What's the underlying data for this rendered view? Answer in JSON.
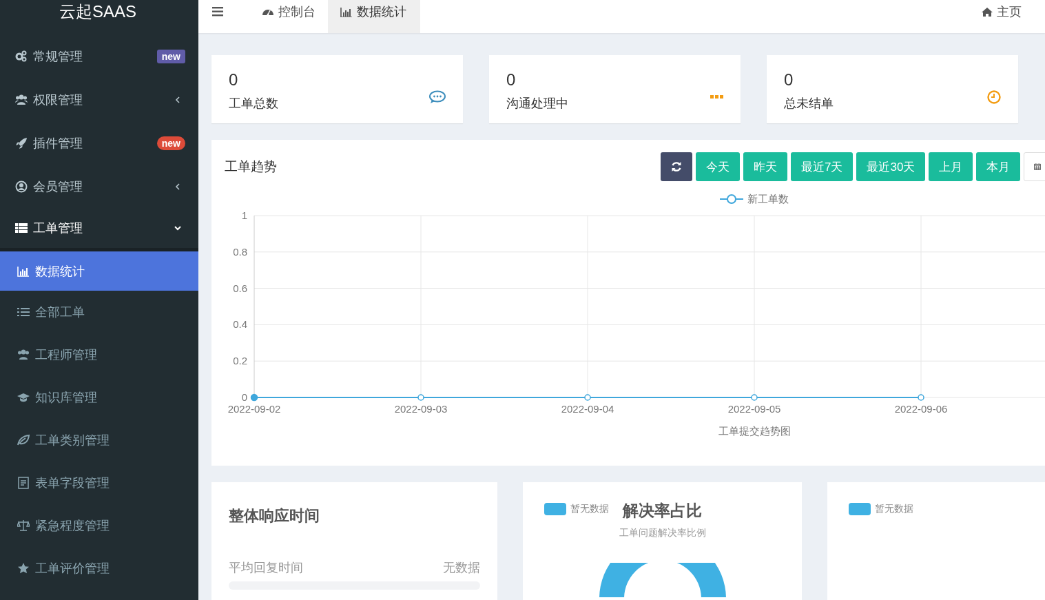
{
  "brand": "云起SAAS",
  "sidebar": {
    "items": [
      {
        "label": "常规管理",
        "badge": {
          "text": "new",
          "color": "#605ca8"
        }
      },
      {
        "label": "权限管理",
        "expanded": false
      },
      {
        "label": "插件管理",
        "badge": {
          "text": "new",
          "color": "#dd4b39"
        }
      },
      {
        "label": "会员管理",
        "expanded": false
      },
      {
        "label": "工单管理",
        "expanded": true,
        "children": [
          {
            "label": "数据统计",
            "selected": true
          },
          {
            "label": "全部工单",
            "selected": false
          },
          {
            "label": "工程师管理",
            "selected": false
          },
          {
            "label": "知识库管理",
            "selected": false
          },
          {
            "label": "工单类别管理",
            "selected": false
          },
          {
            "label": "表单字段管理",
            "selected": false
          },
          {
            "label": "紧急程度管理",
            "selected": false
          },
          {
            "label": "工单评价管理",
            "selected": false
          }
        ]
      }
    ]
  },
  "header": {
    "tabs": [
      {
        "label": "控制台",
        "selected": false
      },
      {
        "label": "数据统计",
        "selected": true
      }
    ],
    "home": "主页"
  },
  "stats": [
    {
      "value": "0",
      "label": "工单总数"
    },
    {
      "value": "0",
      "label": "沟通处理中"
    },
    {
      "value": "0",
      "label": "总未结单"
    }
  ],
  "trend": {
    "title": "工单趋势",
    "buttons": [
      "今天",
      "昨天",
      "最近7天",
      "最近30天",
      "上月",
      "本月"
    ],
    "chart_data": {
      "type": "line",
      "grid": true,
      "xlabel": "工单提交趋势图",
      "categories": [
        "2022-09-02",
        "2022-09-03",
        "2022-09-04",
        "2022-09-05",
        "2022-09-06"
      ],
      "ylim": [
        0,
        1
      ],
      "yticks": [
        0,
        0.2,
        0.4,
        0.6,
        0.8,
        1
      ],
      "series": [
        {
          "name": "新工单数",
          "color": "#3fa7dc",
          "marker": true,
          "values": [
            0,
            0,
            0,
            0,
            0
          ]
        }
      ]
    }
  },
  "response": {
    "title": "整体响应时间",
    "rows": [
      {
        "label": "平均回复时间",
        "value": "无数据",
        "level": 0
      }
    ]
  },
  "resolution": {
    "legend": "暂无数据",
    "title": "解决率占比",
    "subtitle": "工单问题解决率比例"
  },
  "third": {
    "legend": "暂无数据"
  }
}
